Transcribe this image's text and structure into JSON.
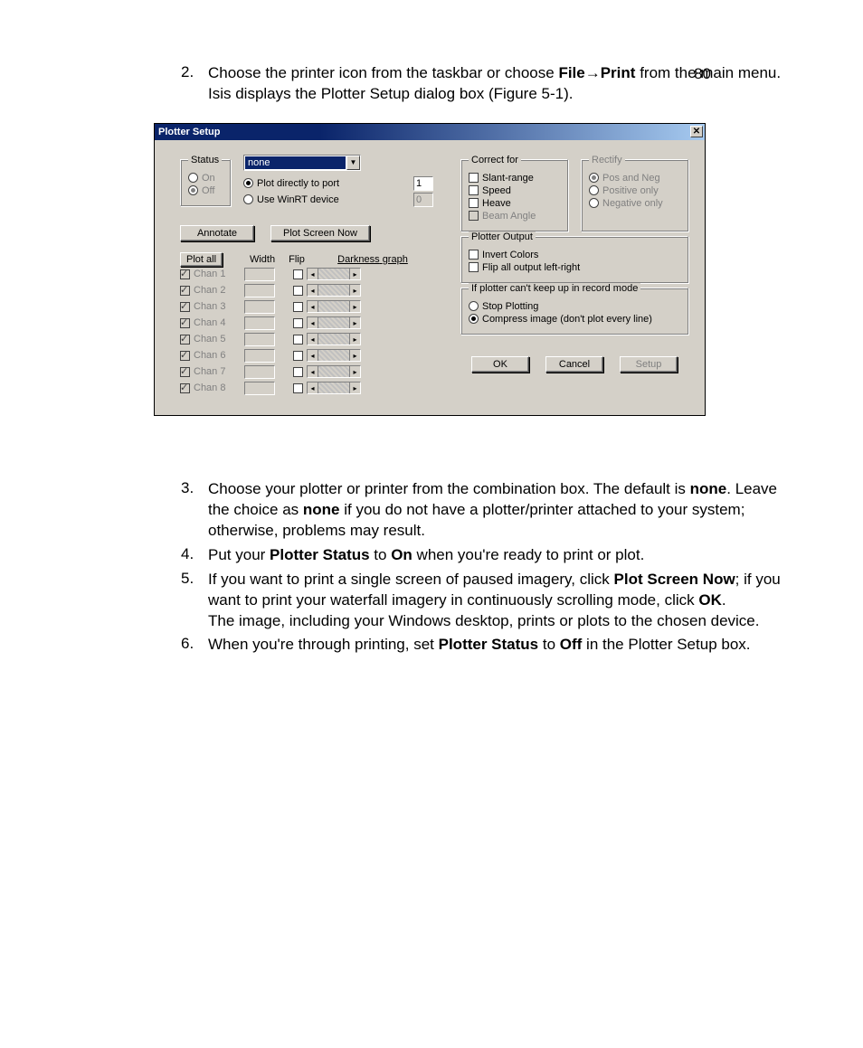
{
  "page_number": "80",
  "step2": {
    "line1_a": "Choose the printer icon from the taskbar or choose ",
    "line1_b_bold": "File→Print",
    "line2": "from the main menu.",
    "line3": "Isis displays the Plotter Setup dialog box (Figure 5-1)."
  },
  "dialog": {
    "title": "Plotter Setup",
    "status": {
      "legend": "Status",
      "on": "On",
      "off": "Off"
    },
    "combo_value": "none",
    "plot_direct": "Plot directly to port",
    "plot_direct_val": "1",
    "use_winrt": "Use WinRT device",
    "use_winrt_val": "0",
    "annotate": "Annotate",
    "plot_screen_now": "Plot Screen Now",
    "plot_all": "Plot all",
    "hdr_width": "Width",
    "hdr_flip": "Flip",
    "hdr_dark": "Darkness",
    "hdr_graph": "graph",
    "chans": [
      "Chan 1",
      "Chan 2",
      "Chan 3",
      "Chan 4",
      "Chan 5",
      "Chan 6",
      "Chan 7",
      "Chan 8"
    ],
    "correct": {
      "legend": "Correct for",
      "slant": "Slant-range",
      "speed": "Speed",
      "heave": "Heave",
      "beam": "Beam Angle"
    },
    "rectify": {
      "legend": "Rectify",
      "both": "Pos and Neg",
      "pos": "Positive only",
      "neg": "Negative only"
    },
    "output": {
      "legend": "Plotter Output",
      "invert": "Invert Colors",
      "flip": "Flip all output left-right"
    },
    "keepup": {
      "legend": "If plotter can't keep up in record mode",
      "stop": "Stop Plotting",
      "compress": "Compress image (don't plot every line)"
    },
    "ok": "OK",
    "cancel": "Cancel",
    "setup": "Setup"
  },
  "step3": {
    "a": "Choose your plotter or printer from the combination box. The default is ",
    "b_bold": "none",
    "c": ". Leave the choice as ",
    "d_bold": "none",
    "e": " if you do not have a plotter/printer attached to your system; otherwise, problems may result."
  },
  "step4": {
    "a": "Put your ",
    "b_bold": "Plotter Status",
    "c": " to ",
    "d_bold": "On",
    "e": " when you're ready to print or plot."
  },
  "step5": {
    "a": "If you want to print a single screen of paused imagery, click ",
    "b_bold": "Plot Screen Now",
    "c": "; if you want to print your waterfall imagery in continuously scrolling mode, click ",
    "d_bold": "OK",
    "e": ".",
    "f": "The image, including your Windows desktop, prints or plots to the chosen device."
  },
  "step6": {
    "a": "When you're through printing, set ",
    "b_bold": "Plotter Status",
    "c": " to ",
    "d_bold": "Off",
    "e": " in the Plotter Setup box."
  }
}
